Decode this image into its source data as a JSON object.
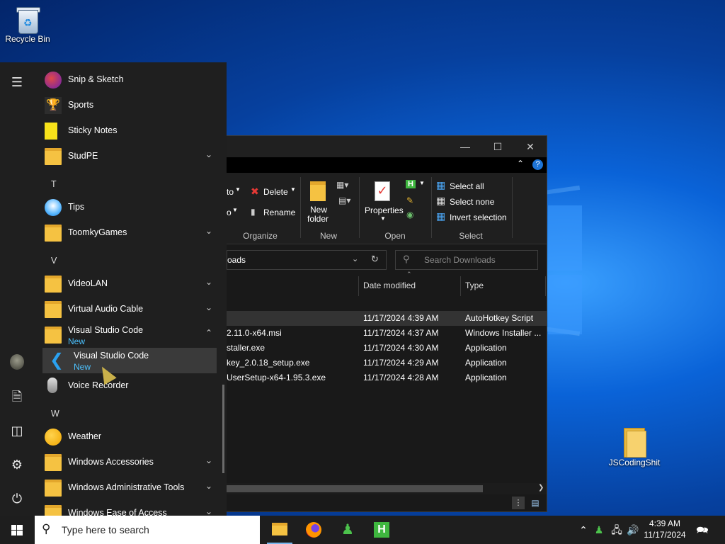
{
  "desktop": {
    "icons": [
      {
        "label": "Recycle Bin"
      },
      {
        "label": "JSCodingShit"
      }
    ]
  },
  "start_menu": {
    "apps": [
      {
        "label": "Snip & Sketch",
        "icon": "snip-sketch-icon"
      },
      {
        "label": "Sports",
        "icon": "trophy-icon"
      },
      {
        "label": "Sticky Notes",
        "icon": "sticky-notes-icon"
      },
      {
        "label": "StudPE",
        "icon": "folder-icon",
        "expandable": true
      },
      {
        "label": "Tips",
        "icon": "lightbulb-icon"
      },
      {
        "label": "ToomkyGames",
        "icon": "folder-icon",
        "expandable": true
      },
      {
        "label": "VideoLAN",
        "icon": "folder-icon",
        "expandable": true
      },
      {
        "label": "Virtual Audio Cable",
        "icon": "folder-icon",
        "expandable": true
      },
      {
        "label": "Visual Studio Code",
        "badge": "New",
        "icon": "folder-icon",
        "expanded": true
      },
      {
        "label": "Visual Studio Code",
        "badge": "New",
        "icon": "vscode-icon",
        "highlighted": true
      },
      {
        "label": "Voice Recorder",
        "icon": "microphone-icon"
      },
      {
        "label": "Weather",
        "icon": "weather-icon"
      },
      {
        "label": "Windows Accessories",
        "icon": "folder-icon",
        "expandable": true
      },
      {
        "label": "Windows Administrative Tools",
        "icon": "folder-icon",
        "expandable": true
      },
      {
        "label": "Windows Ease of Access",
        "icon": "folder-icon",
        "expandable": true
      }
    ],
    "letters": [
      "T",
      "V",
      "W"
    ],
    "rail": [
      "hamburger-icon",
      "user-avatar",
      "documents-icon",
      "pictures-icon",
      "settings-icon",
      "power-icon"
    ]
  },
  "explorer": {
    "ribbon": {
      "move_to": "to",
      "copy_to": "o",
      "delete": "Delete",
      "rename": "Rename",
      "new_folder_line1": "New",
      "new_folder_line2": "folder",
      "properties": "Properties",
      "select_all": "Select all",
      "select_none": "Select none",
      "invert_selection": "Invert selection",
      "groups": {
        "organize": "Organize",
        "new": "New",
        "open": "Open",
        "select": "Select"
      }
    },
    "address": "oads",
    "search_placeholder": "Search Downloads",
    "columns": {
      "date": "Date modified",
      "type": "Type"
    },
    "files": [
      {
        "name": "",
        "date": "11/17/2024 4:39 AM",
        "type": "AutoHotkey Script",
        "selected": true
      },
      {
        "name": "2.11.0-x64.msi",
        "date": "11/17/2024 4:37 AM",
        "type": "Windows Installer ..."
      },
      {
        "name": "staller.exe",
        "date": "11/17/2024 4:30 AM",
        "type": "Application"
      },
      {
        "name": "key_2.0.18_setup.exe",
        "date": "11/17/2024 4:29 AM",
        "type": "Application"
      },
      {
        "name": "UserSetup-x64-1.95.3.exe",
        "date": "11/17/2024 4:28 AM",
        "type": "Application"
      }
    ]
  },
  "taskbar": {
    "search_placeholder": "Type here to search",
    "apps": [
      "file-explorer-icon",
      "firefox-icon",
      "people-app-icon",
      "hotkey-app-icon"
    ],
    "clock_time": "4:39 AM",
    "clock_date": "11/17/2024"
  }
}
